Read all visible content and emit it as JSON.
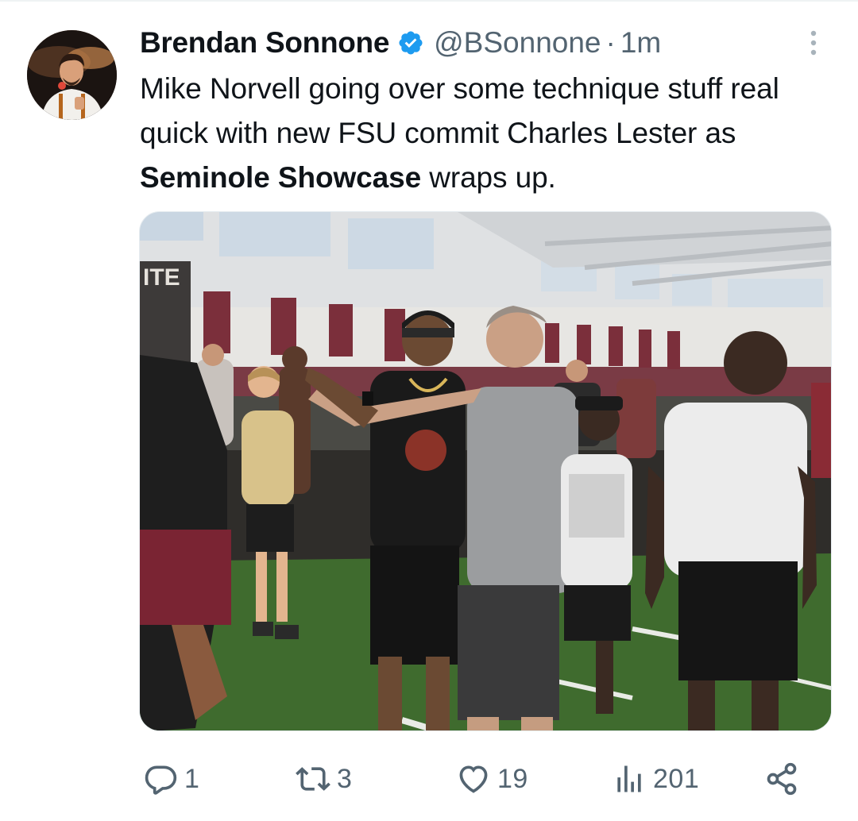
{
  "tweet": {
    "author_name": "Brendan Sonnone",
    "handle": "@BSonnone",
    "separator": "·",
    "time": "1m",
    "text_part1": "Mike Norvell going over some technique stuff real quick with new FSU commit Charles Lester as ",
    "text_bold": "Seminole Showcase",
    "text_part2": " wraps up."
  },
  "photo": {
    "banner_text": "ITE"
  },
  "actions": {
    "replies": "1",
    "retweets": "3",
    "likes": "19",
    "views": "201"
  },
  "colors": {
    "text": "#0f1419",
    "secondary": "#536471",
    "verified": "#1d9bf0",
    "garnet": "#782f40",
    "turf": "#3f6b2e"
  },
  "icons": [
    "verified-badge-icon",
    "more-options-icon",
    "reply-icon",
    "retweet-icon",
    "like-icon",
    "views-icon",
    "share-icon"
  ]
}
